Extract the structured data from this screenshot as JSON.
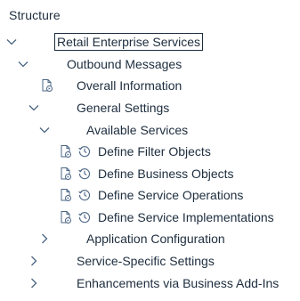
{
  "panel": {
    "title": "Structure"
  },
  "tree": {
    "root": {
      "label": "Retail Enterprise Services",
      "state": "expanded",
      "selected": true
    },
    "outbound": {
      "label": "Outbound Messages",
      "state": "expanded"
    },
    "overall_info": {
      "label": "Overall Information",
      "icon": "document-execute-icon"
    },
    "general_settings": {
      "label": "General Settings",
      "state": "expanded"
    },
    "available_services": {
      "label": "Available Services",
      "state": "expanded"
    },
    "define_filter": {
      "label": "Define Filter Objects",
      "icons": [
        "document-execute-icon",
        "clock-history-icon"
      ]
    },
    "define_business": {
      "label": "Define Business Objects",
      "icons": [
        "document-execute-icon",
        "clock-history-icon"
      ]
    },
    "define_operations": {
      "label": "Define Service Operations",
      "icons": [
        "document-execute-icon",
        "clock-history-icon"
      ]
    },
    "define_implementations": {
      "label": "Define Service Implementations",
      "icons": [
        "document-execute-icon",
        "clock-history-icon"
      ]
    },
    "app_config": {
      "label": "Application Configuration",
      "state": "collapsed"
    },
    "service_specific": {
      "label": "Service-Specific Settings",
      "state": "collapsed"
    },
    "enhancements": {
      "label": "Enhancements via Business Add-Ins",
      "state": "collapsed"
    }
  },
  "colors": {
    "text": "#1d2d3e",
    "chevron": "#4a6584",
    "selection_border": "#1d2d3e"
  }
}
